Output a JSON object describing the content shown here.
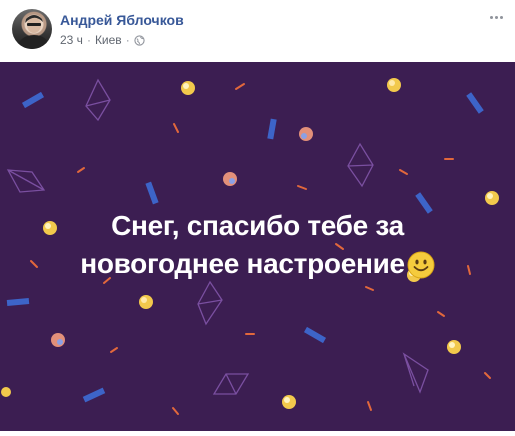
{
  "post": {
    "author": "Андрей Яблочков",
    "time": "23 ч",
    "separator": "·",
    "location": "Киев",
    "audience_icon": "globe-icon",
    "more_icon": "more-options-icon"
  },
  "image": {
    "background_color": "#3c1e52",
    "text_line1": "Снег, спасибо тебе за",
    "text_line2": "новогоднее настроение",
    "emoji": "smiling-face-emoji",
    "text_color": "#ffffff"
  },
  "colors": {
    "name_link": "#385898",
    "meta_text": "#616770",
    "confetti_blue": "#3d64c8",
    "confetti_orange": "#e2683c",
    "confetti_yellow": "#f2c94c",
    "confetti_purple": "#7a4fa0"
  }
}
